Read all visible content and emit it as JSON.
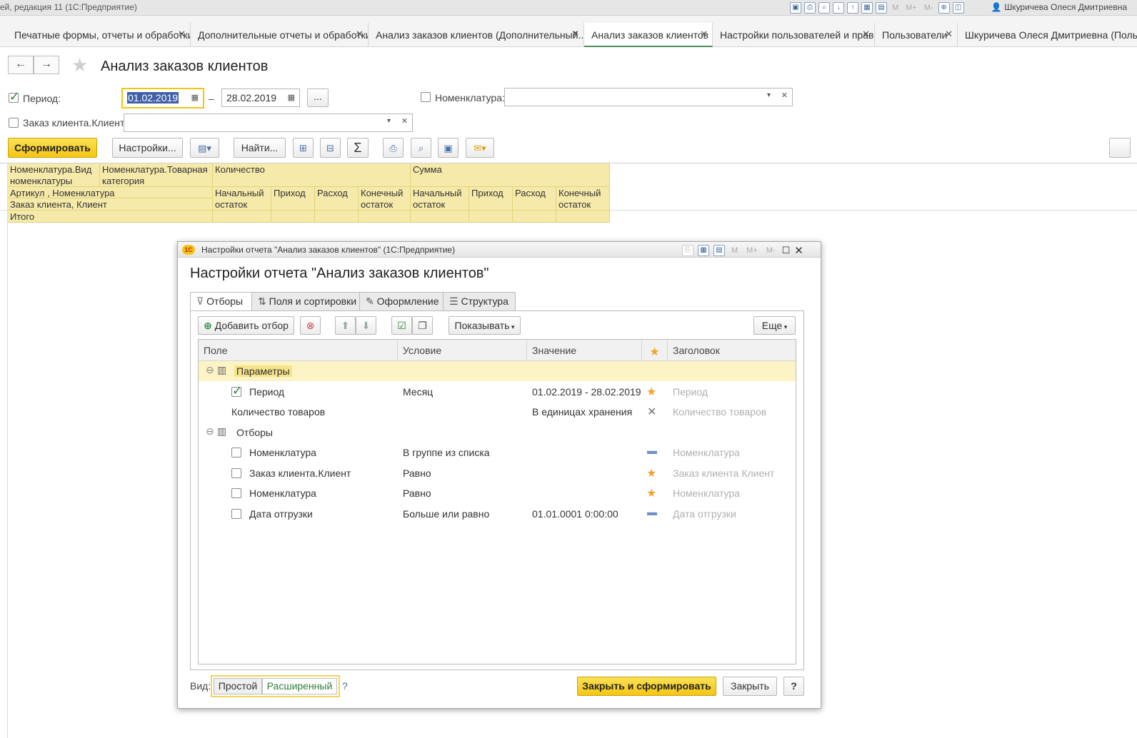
{
  "system_bar": {
    "title": "ей, редакция 11  (1С:Предприятие)",
    "tool_icons": [
      "save-icon",
      "print-icon",
      "preview-icon",
      "download-icon",
      "upload-icon",
      "calc-icon",
      "calendar-icon"
    ],
    "memory_labels": [
      "M",
      "M+",
      "M-"
    ],
    "user": "Шкуричева Олеся Дмитриевна"
  },
  "tabs": [
    {
      "label": "Печатные формы, отчеты и обработки",
      "active": false
    },
    {
      "label": "Дополнительные отчеты и обработки",
      "active": false
    },
    {
      "label": "Анализ заказов клиентов (Дополнительный...",
      "active": false
    },
    {
      "label": "Анализ заказов клиентов",
      "active": true
    },
    {
      "label": "Настройки пользователей и прав",
      "active": false
    },
    {
      "label": "Пользователи",
      "active": false
    },
    {
      "label": "Шкуричева Олеся Дмитриевна (Поль",
      "active": false
    }
  ],
  "header": {
    "title": "Анализ заказов клиентов",
    "back": "←",
    "forward": "→"
  },
  "params": {
    "period_label": "Период:",
    "period_checked": true,
    "date_from": "01.02.2019",
    "date_dash": "–",
    "date_to": "28.02.2019",
    "ellipsis": "...",
    "nomenclature_label": "Номенклатура:",
    "nomenclature_checked": false,
    "client_label": "Заказ клиента.Клиент:",
    "client_checked": false
  },
  "toolbar": {
    "generate": "Сформировать",
    "settings": "Настройки...",
    "find": "Найти...",
    "sum_icon": "Σ"
  },
  "grid": {
    "h_nom_kind": "Номенклатура.Вид номенклатуры",
    "h_nom_cat": "Номенклатура.Товарная категория",
    "h_qty": "Количество",
    "h_sum": "Сумма",
    "h_article": "Артикул , Номенклатура",
    "h_client": "Заказ клиента, Клиент",
    "h_start": "Начальный остаток",
    "h_in": "Приход",
    "h_out": "Расход",
    "h_end": "Конечный остаток",
    "total": "Итого"
  },
  "dialog": {
    "window_title": "Настройки отчета \"Анализ заказов клиентов\"  (1С:Предприятие)",
    "logo": "1С",
    "heading": "Настройки отчета \"Анализ заказов клиентов\"",
    "tabs": [
      "Отборы",
      "Поля и сортировки",
      "Оформление",
      "Структура"
    ],
    "add_filter": "Добавить отбор",
    "show": "Показывать",
    "more": "Еще",
    "columns": {
      "field": "Поле",
      "condition": "Условие",
      "value": "Значение",
      "header": "Заголовок"
    },
    "rows": [
      {
        "field": "Параметры",
        "group": true
      },
      {
        "field": "Период",
        "checked": true,
        "condition": "Месяц",
        "value": "01.02.2019 - 28.02.2019",
        "mark": "star",
        "title": "Период"
      },
      {
        "field": "Количество товаров",
        "condition": "",
        "value": "В единицах хранения",
        "mark": "cross",
        "title": "Количество товаров"
      },
      {
        "field": "Отборы",
        "group": true
      },
      {
        "field": "Номенклатура",
        "checked": false,
        "condition": "В группе из списка",
        "value": "",
        "mark": "dash",
        "title": "Номенклатура"
      },
      {
        "field": "Заказ клиента.Клиент",
        "checked": false,
        "condition": "Равно",
        "value": "",
        "mark": "star",
        "title": "Заказ клиента Клиент"
      },
      {
        "field": "Номенклатура",
        "checked": false,
        "condition": "Равно",
        "value": "",
        "mark": "star",
        "title": "Номенклатура"
      },
      {
        "field": "Дата отгрузки",
        "checked": false,
        "condition": "Больше или равно",
        "value": "01.01.0001 0:00:00",
        "mark": "dash",
        "title": "Дата отгрузки"
      }
    ],
    "footer": {
      "view_label": "Вид:",
      "simple": "Простой",
      "advanced": "Расширенный",
      "help": "?",
      "close_generate": "Закрыть и сформировать",
      "close": "Закрыть",
      "question": "?"
    }
  }
}
